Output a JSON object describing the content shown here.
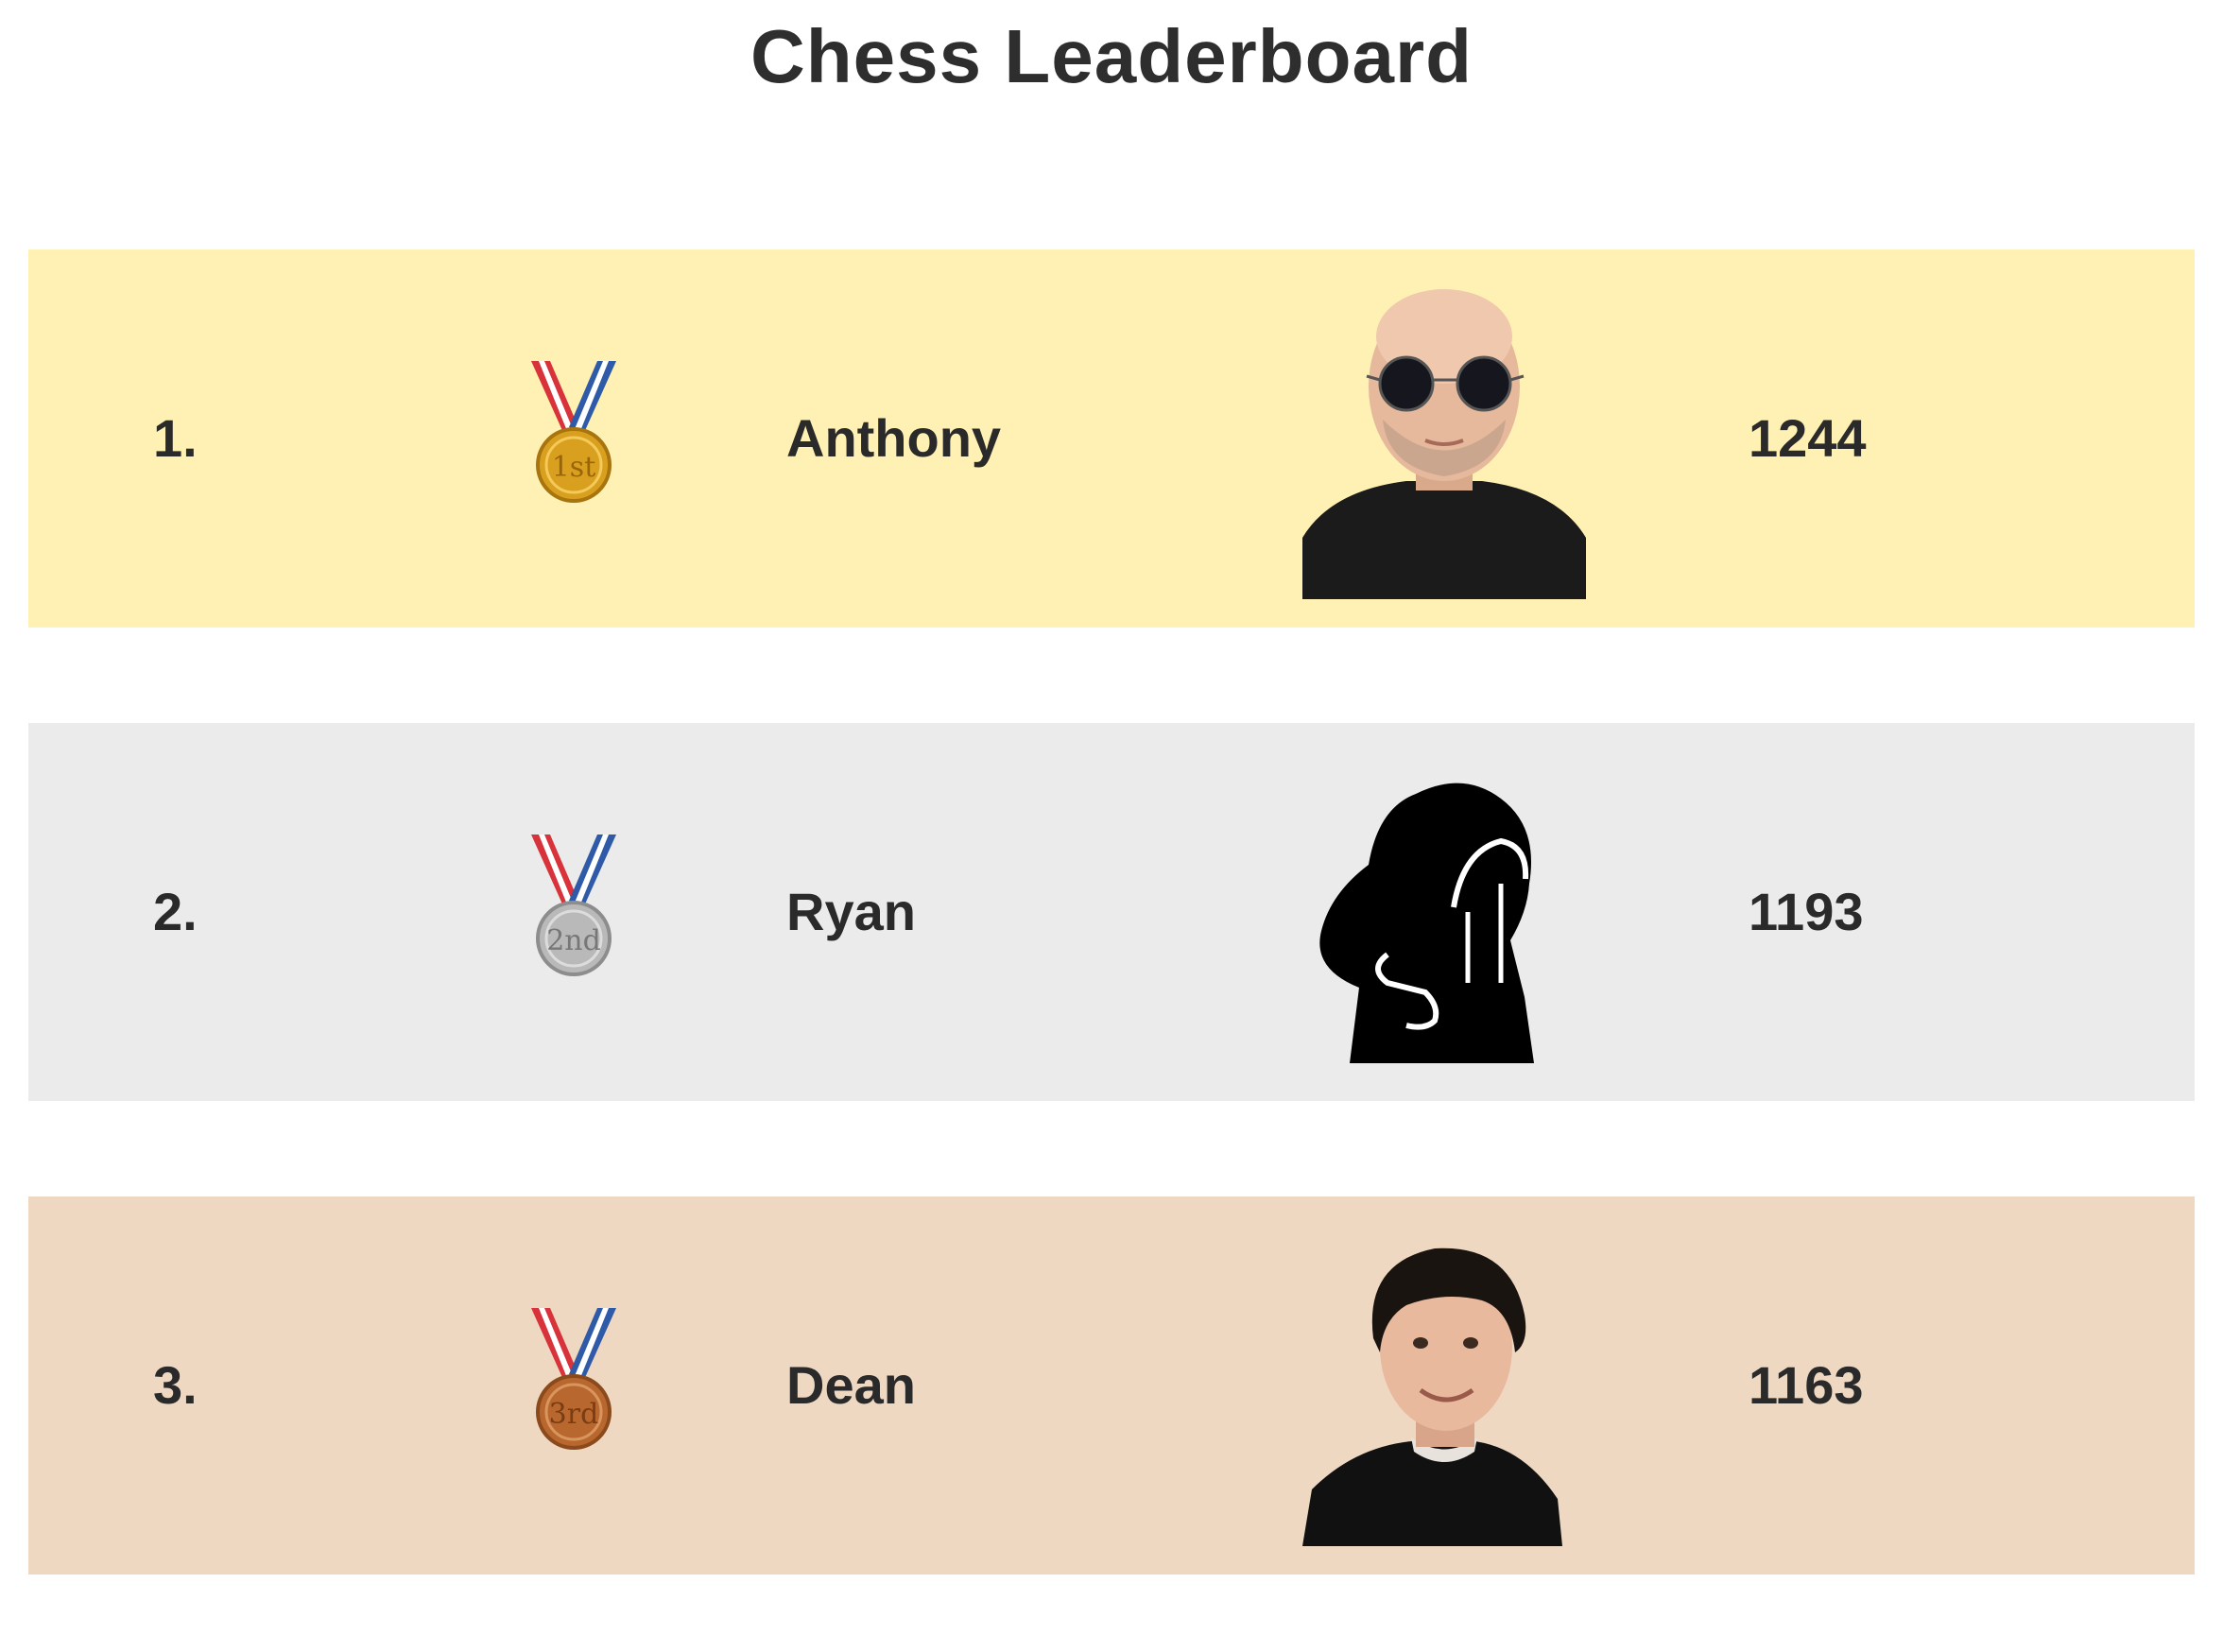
{
  "title": "Chess Leaderboard",
  "colors": {
    "gold_row": "#fff1b3",
    "silver_row": "#ebebeb",
    "bronze_row": "#efd8c2",
    "gold_medal": "#d9a020",
    "silver_medal": "#b9b9b9",
    "bronze_medal": "#b8682e",
    "ribbon_red": "#d8323a",
    "ribbon_blue": "#2e5aa8"
  },
  "rows": [
    {
      "rank": "1.",
      "medal_icon": "gold-medal-icon",
      "medal_text": "1st",
      "name": "Anthony",
      "avatar_icon": "person-sunglasses-photo",
      "score": "1244"
    },
    {
      "rank": "2.",
      "medal_icon": "silver-medal-icon",
      "medal_text": "2nd",
      "name": "Ryan",
      "avatar_icon": "hooded-figure-icon",
      "score": "1193"
    },
    {
      "rank": "3.",
      "medal_icon": "bronze-medal-icon",
      "medal_text": "3rd",
      "name": "Dean",
      "avatar_icon": "person-curly-hair-photo",
      "score": "1163"
    }
  ]
}
